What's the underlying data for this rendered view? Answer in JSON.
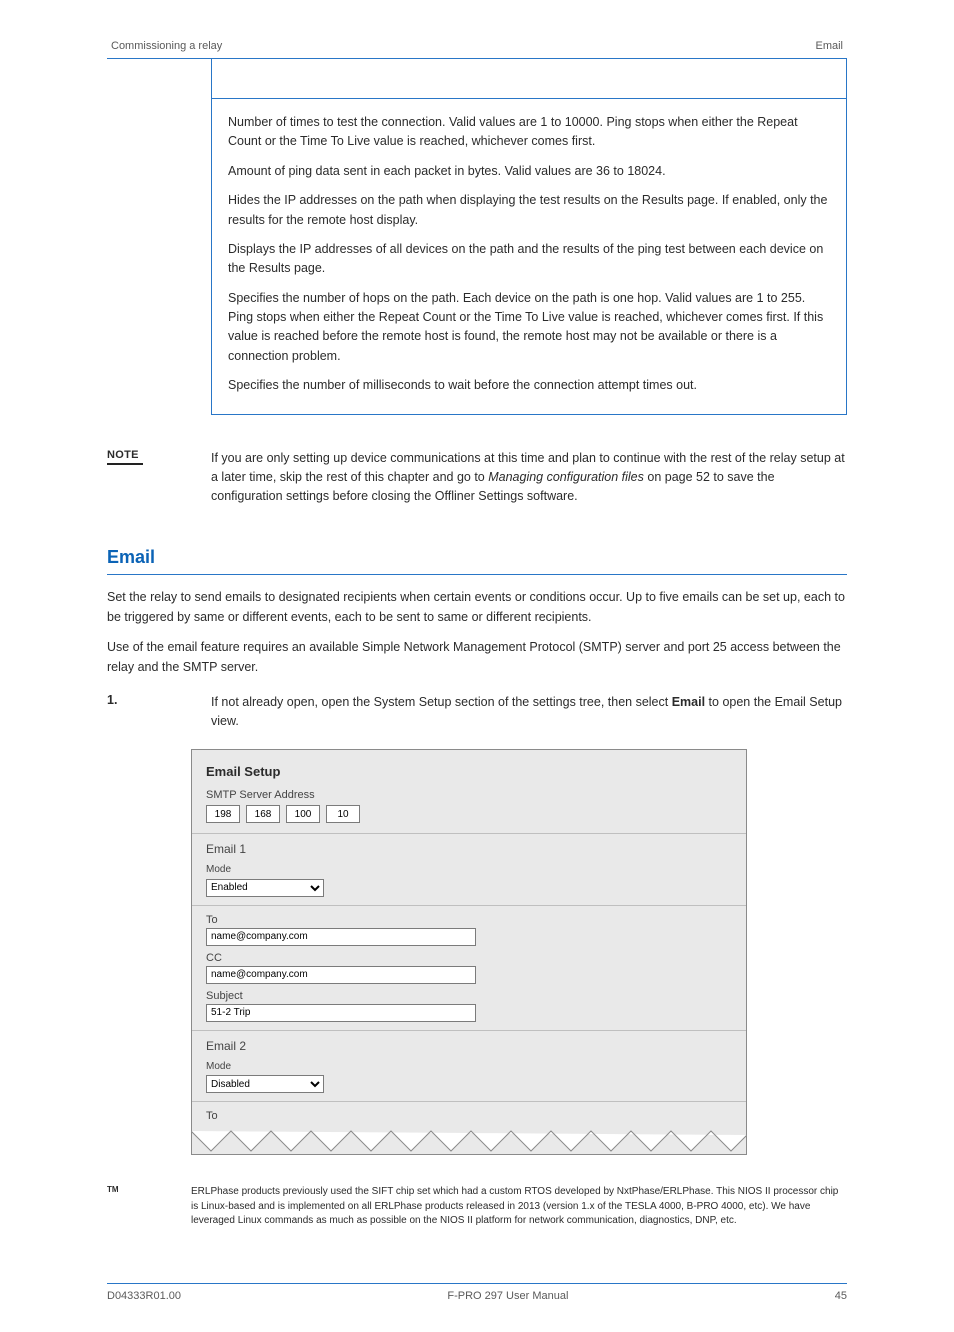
{
  "header": {
    "left": "Commissioning a relay",
    "right": "Email"
  },
  "topbox": {
    "paragraphs": [
      "Number of times to test the connection. Valid values are 1 to 10000. Ping stops when either the Repeat Count or the Time To Live value is reached, whichever comes first.",
      "Amount of ping data sent in each packet in bytes. Valid values are 36 to 18024.",
      "Hides the IP addresses on the path when displaying the test results on the Results page. If enabled, only the results for the remote host display.",
      "Displays the IP addresses of all devices on the path and the results of the ping test between each device on the Results page.",
      "Specifies the number of hops on the path. Each device on the path is one hop. Valid values are 1 to 255. Ping stops when either the Repeat Count or the Time To Live value is reached, whichever comes first. If this value is reached before the remote host is found, the remote host may not be available or there is a connection problem.",
      "Specifies the number of milliseconds to wait before the connection attempt times out."
    ]
  },
  "note": {
    "label": "NOTE",
    "text_pre": "If you are only setting up device communications at this time and plan to continue with the rest of the relay setup at a later time, skip the rest of this chapter and go to ",
    "text_ital": "Managing configuration files",
    "text_post": " on page 52 to save the configuration settings before closing the Offliner Settings software."
  },
  "section": {
    "title": "Email",
    "paragraphs": [
      "Set the relay to send emails to designated recipients when certain events or conditions occur. Up to five emails can be set up, each to be triggered by same or different events, each to be sent to same or different recipients.",
      "Use of the email feature requires an available Simple Network Management Protocol (SMTP) server and port 25 access between the relay and the SMTP server."
    ]
  },
  "step": {
    "number": "1.",
    "text_pre": "If not already open, open the System Setup section of the settings tree, then select ",
    "text_bold": "Email",
    "text_post": " to open the Email Setup view."
  },
  "shot": {
    "title": "Email Setup",
    "smtp_label": "SMTP Server Address",
    "ip": [
      "198",
      "168",
      "100",
      "10"
    ],
    "email1": {
      "heading": "Email 1",
      "mode_label": "Mode",
      "mode_value": "Enabled",
      "to_label": "To",
      "to_value": "name@company.com",
      "cc_label": "CC",
      "cc_value": "name@company.com",
      "subject_label": "Subject",
      "subject_value": "51-2 Trip"
    },
    "email2": {
      "heading": "Email 2",
      "mode_label": "Mode",
      "mode_value": "Disabled",
      "to_label": "To"
    }
  },
  "tm": {
    "mark": "TM",
    "text": "ERLPhase products previously used the SIFT chip set which had a custom RTOS developed by NxtPhase/ERLPhase. This NIOS II processor chip is Linux-based and is implemented on all ERLPhase products released in 2013 (version 1.x of the TESLA 4000, B-PRO 4000, etc). We have leveraged Linux commands as much as possible on the NIOS II platform for network communication, diagnostics, DNP, etc."
  },
  "footer": {
    "left": "D04333R01.00",
    "center": "F-PRO 297 User Manual",
    "right": "45"
  }
}
